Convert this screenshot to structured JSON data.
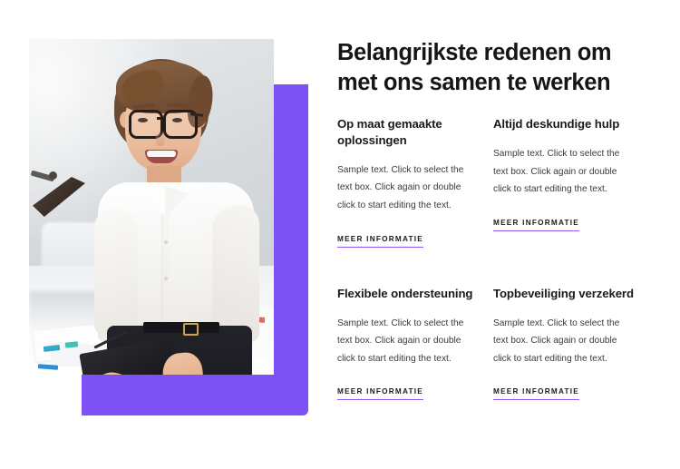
{
  "headline": "Belangrijkste redenen om met ons samen te werken",
  "image": {
    "alt": "Smiling businesswoman with glasses holding a tablet in an office",
    "accent_color": "#7c52f4"
  },
  "colors": {
    "accent": "#7c52f4",
    "link_underline": "#8b5cf6",
    "heading": "#16161a",
    "body_text": "#3a3a3e"
  },
  "features": [
    {
      "title": "Op maat gemaakte oplossingen",
      "text": "Sample text. Click to select the text box. Click again or double click to start editing the text.",
      "link": "MEER INFORMATIE"
    },
    {
      "title": "Altijd deskundige hulp",
      "text": "Sample text. Click to select the text box. Click again or double click to start editing the text.",
      "link": "MEER INFORMATIE"
    },
    {
      "title": "Flexibele ondersteuning",
      "text": "Sample text. Click to select the text box. Click again or double click to start editing the text.",
      "link": "MEER INFORMATIE"
    },
    {
      "title": "Topbeveiliging verzekerd",
      "text": "Sample text. Click to select the text box. Click again or double click to start editing the text.",
      "link": "MEER INFORMATIE"
    }
  ]
}
